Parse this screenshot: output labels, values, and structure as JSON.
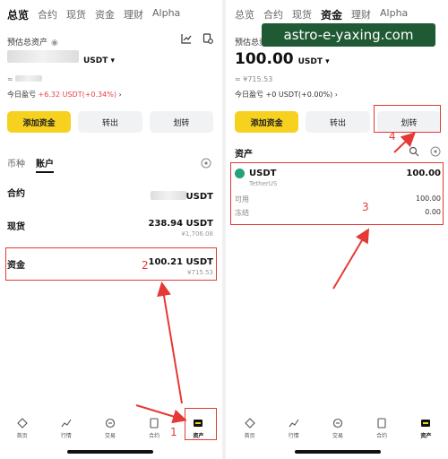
{
  "left": {
    "tabs": [
      "总览",
      "合约",
      "现货",
      "资金",
      "理财",
      "Alpha"
    ],
    "estimated_label": "预估总资产",
    "total_currency": "USDT",
    "fiat_prefix": "≈",
    "pnl_label": "今日盈亏",
    "pnl_value": "+6.32 USDT(+0.34%)",
    "actions": [
      "添加资金",
      "转出",
      "划转"
    ],
    "sub_tabs": [
      "币种",
      "账户"
    ],
    "accounts": [
      {
        "name": "合约",
        "amount": "USDT",
        "fiat": ""
      },
      {
        "name": "现货",
        "amount": "238.94 USDT",
        "fiat": "¥1,706.08"
      },
      {
        "name": "资金",
        "amount": "100.21 USDT",
        "fiat": "¥715.53"
      }
    ],
    "annotations": [
      "2",
      "1"
    ]
  },
  "right": {
    "tabs": [
      "总览",
      "合约",
      "现货",
      "资金",
      "理财",
      "Alpha"
    ],
    "estimated_label": "预估总资产",
    "total_value": "100.00",
    "total_currency": "USDT",
    "fiat": "≈ ¥715.53",
    "pnl_label": "今日盈亏",
    "pnl_value": "+0 USDT(+0.00%)",
    "actions": [
      "添加资金",
      "转出",
      "划转"
    ],
    "assets_title": "资产",
    "usdt": {
      "symbol": "USDT",
      "amount": "100.00",
      "name": "TetherUS",
      "available_label": "可用",
      "available": "100.00",
      "frozen_label": "冻结",
      "frozen": "0.00"
    },
    "annotations": [
      "3",
      "4"
    ]
  },
  "nav": [
    "首页",
    "行情",
    "交易",
    "合约",
    "资产"
  ],
  "watermark": "astro-e-yaxing.com",
  "colors": {
    "accent": "#f6d11f",
    "annotation": "#e53935",
    "loss": "#e5434b",
    "coin": "#26a17b"
  }
}
